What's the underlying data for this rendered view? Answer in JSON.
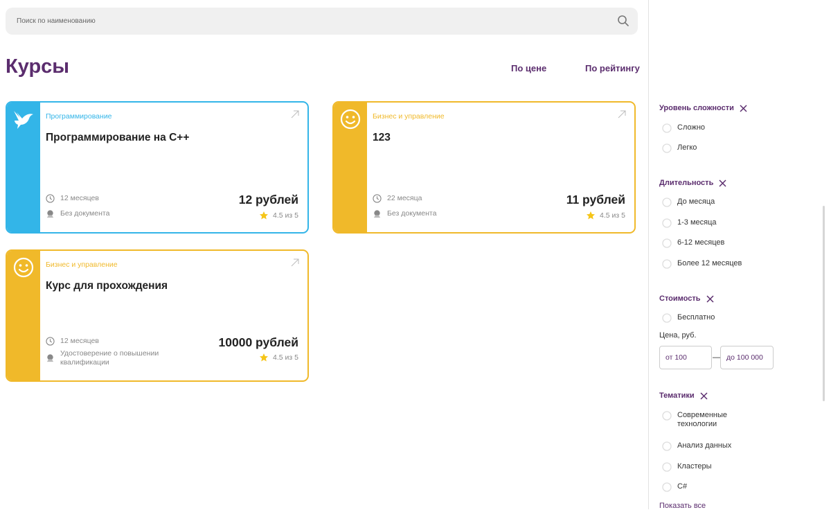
{
  "search": {
    "placeholder": "Поиск по наименованию",
    "icon": "search-icon"
  },
  "page_title": "Курсы",
  "sort": {
    "price_label": "По цене",
    "rating_label": "По рейтингу"
  },
  "colors": {
    "accent": "#5b2d6e",
    "blue": "#33b5e8",
    "yellow": "#f0b92a",
    "star": "#f5c518"
  },
  "courses": [
    {
      "category": "Программирование",
      "title": "Программирование на С++",
      "duration": "12 месяцев",
      "document": "Без документа",
      "price": "12 рублей",
      "rating": "4.5 из 5",
      "icon": "bird-icon"
    },
    {
      "category": "Бизнес и управление",
      "title": "123",
      "duration": "22 месяца",
      "document": "Без документа",
      "price": "11 рублей",
      "rating": "4.5 из 5",
      "icon": "smiley-icon"
    },
    {
      "category": "Бизнес и управление",
      "title": "Курс для прохождения",
      "duration": "12 месяцев",
      "document": "Удостоверение о повышении квалификации",
      "price": "10000 рублей",
      "rating": "4.5 из 5",
      "icon": "smiley-icon"
    }
  ],
  "filters": {
    "difficulty": {
      "title": "Уровень сложности",
      "options": [
        "Сложно",
        "Легко"
      ]
    },
    "duration": {
      "title": "Длительность",
      "options": [
        "До месяца",
        "1-3 месяца",
        "6-12 месяцев",
        "Более 12 месяцев"
      ]
    },
    "cost": {
      "title": "Стоимость",
      "options": [
        "Бесплатно"
      ],
      "price_label": "Цена, руб.",
      "from_placeholder": "от 100",
      "to_placeholder": "до 100 000"
    },
    "topics": {
      "title": "Тематики",
      "options": [
        "Современные технологии",
        "Анализ данных",
        "Кластеры",
        "C#"
      ],
      "show_all": "Показать все"
    }
  }
}
